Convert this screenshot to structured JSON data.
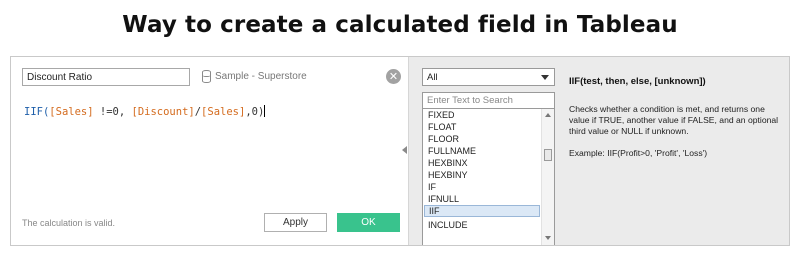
{
  "headline": "Way to create a calculated field in Tableau",
  "editor": {
    "calc_name": "Discount Ratio",
    "datasource": "Sample - Superstore",
    "close_glyph": "✕",
    "formula": {
      "fn": "IIF(",
      "f1": "[Sales]",
      "op1": " !=0, ",
      "f2": "[Discount]",
      "slash": "/",
      "f3": "[Sales]",
      "end": ",0)"
    },
    "status": "The calculation is valid.",
    "apply_label": "Apply",
    "ok_label": "OK"
  },
  "functions": {
    "category": "All",
    "search_placeholder": "Enter Text to Search",
    "items": [
      "FIXED",
      "FLOAT",
      "FLOOR",
      "FULLNAME",
      "HEXBINX",
      "HEXBINY",
      "IF",
      "IFNULL",
      "IIF",
      "INCLUDE"
    ],
    "selected": "IIF"
  },
  "help": {
    "signature": "IIF(test, then, else, [unknown])",
    "description": "Checks whether a condition is met, and returns one value if TRUE, another value if FALSE, and an optional third value or NULL if unknown.",
    "example": "Example: IIF(Profit>0, 'Profit', 'Loss')"
  },
  "colors": {
    "ok_button": "#39c38d",
    "keyword": "#1f5faa",
    "field": "#d46b1e",
    "selection": "#dbe8f6"
  }
}
